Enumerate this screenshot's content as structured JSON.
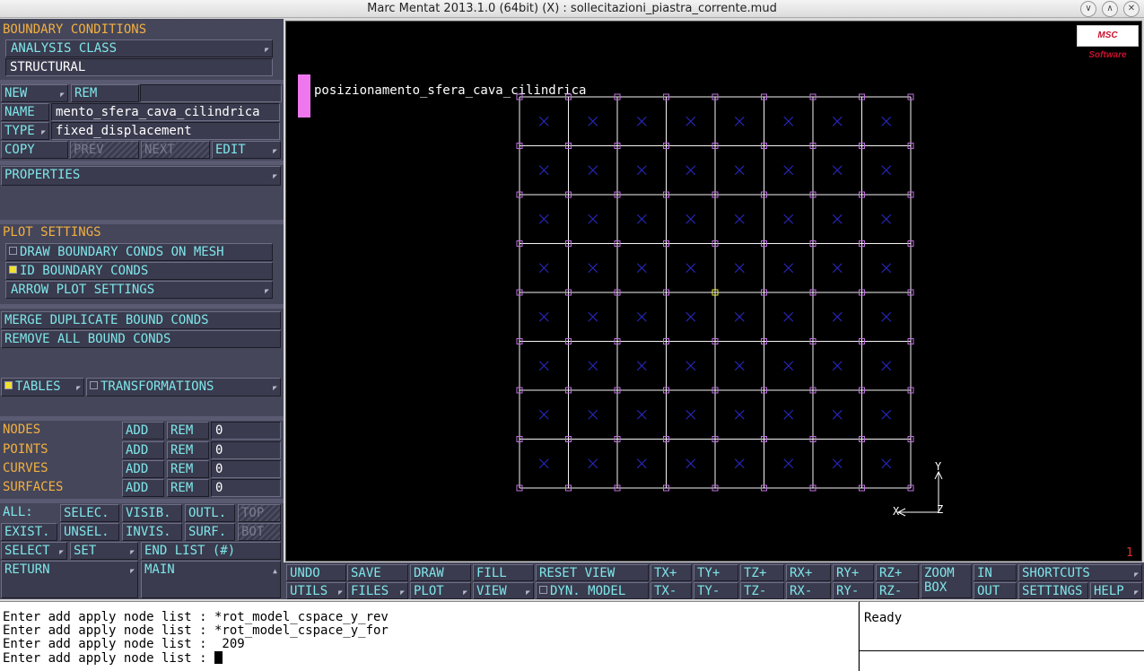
{
  "window": {
    "title": "Marc Mentat 2013.1.0 (64bit) (X) : sollecitazioni_piastra_corrente.mud",
    "buttons": [
      "∨",
      "∧",
      "✕"
    ]
  },
  "left_panel": {
    "heading": "BOUNDARY CONDITIONS",
    "analysis_class_btn": "ANALYSIS CLASS",
    "analysis_class_value": "STRUCTURAL",
    "new_btn": "NEW",
    "rem_btn": "REM",
    "name_label": "NAME",
    "name_value": "mento_sfera_cava_cilindrica",
    "type_label": "TYPE",
    "type_value": "fixed_displacement",
    "copy_btn": "COPY",
    "prev_btn": "PREV",
    "next_btn": "NEXT",
    "edit_btn": "EDIT",
    "properties_btn": "PROPERTIES",
    "plot_settings_label": "PLOT SETTINGS",
    "draw_bc_btn": "DRAW BOUNDARY CONDS ON MESH",
    "id_bc_btn": "ID BOUNDARY CONDS",
    "arrow_plot_btn": "ARROW PLOT SETTINGS",
    "merge_btn": "MERGE DUPLICATE BOUND CONDS",
    "remove_all_btn": "REMOVE ALL BOUND CONDS",
    "tables_btn": "TABLES",
    "transformations_btn": "TRANSFORMATIONS",
    "entities": [
      {
        "label": "NODES",
        "add": "ADD",
        "rem": "REM",
        "count": "0"
      },
      {
        "label": "POINTS",
        "add": "ADD",
        "rem": "REM",
        "count": "0"
      },
      {
        "label": "CURVES",
        "add": "ADD",
        "rem": "REM",
        "count": "0"
      },
      {
        "label": "SURFACES",
        "add": "ADD",
        "rem": "REM",
        "count": "0"
      }
    ],
    "all_label": "ALL:",
    "selec_btn": "SELEC.",
    "visib_btn": "VISIB.",
    "outl_btn": "OUTL.",
    "top_btn": "TOP",
    "exist_btn": "EXIST.",
    "unsel_btn": "UNSEL.",
    "invis_btn": "INVIS.",
    "surf_btn": "SURF.",
    "bot_btn": "BOT",
    "select_btn": "SELECT",
    "set_btn": "SET",
    "end_list_btn": "END LIST (#)",
    "return_btn": "RETURN",
    "main_btn": "MAIN"
  },
  "viewport": {
    "logo": "MSC Software",
    "bc_label": "posizionamento_sfera_cava_cilindrica",
    "bc_color": "#ee77ee",
    "axis_y": "Y",
    "axis_x": "X",
    "axis_z": "Z",
    "page_number": "1"
  },
  "toolbar": {
    "undo": "UNDO",
    "save": "SAVE",
    "draw": "DRAW",
    "fill": "FILL",
    "reset_view": "RESET VIEW",
    "txp": "TX+",
    "typ": "TY+",
    "tzp": "TZ+",
    "rxp": "RX+",
    "ryp": "RY+",
    "rzp": "RZ+",
    "zoom": "ZOOM",
    "box": "BOX",
    "in": "IN",
    "shortcuts": "SHORTCUTS",
    "utils": "UTILS",
    "files": "FILES",
    "plot": "PLOT",
    "view": "VIEW",
    "dyn_model": "DYN. MODEL",
    "txm": "TX-",
    "tym": "TY-",
    "tzm": "TZ-",
    "rxm": "RX-",
    "rym": "RY-",
    "rzm": "RZ-",
    "out": "OUT",
    "settings": "SETTINGS",
    "help": "HELP"
  },
  "console": {
    "lines": [
      "Enter add apply node list : *rot_model_cspace_y_rev",
      "Enter add apply node list : *rot_model_cspace_y_for",
      "Enter add apply node list :  209",
      "Enter add apply node list : "
    ],
    "status": "Ready"
  }
}
